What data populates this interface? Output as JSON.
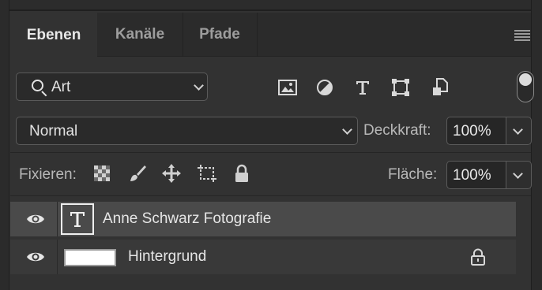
{
  "tabs": [
    {
      "label": "Ebenen",
      "active": true
    },
    {
      "label": "Kanäle",
      "active": false
    },
    {
      "label": "Pfade",
      "active": false
    }
  ],
  "filter": {
    "selected": "Art",
    "icons": [
      "image-filter-icon",
      "adjustment-filter-icon",
      "type-filter-icon",
      "shape-filter-icon",
      "smart-object-filter-icon"
    ]
  },
  "blend": {
    "mode": "Normal",
    "opacity_label": "Deckkraft:",
    "opacity_value": "100%"
  },
  "lock": {
    "label": "Fixieren:",
    "icons": [
      "lock-transparent-pixels-icon",
      "lock-image-pixels-icon",
      "lock-position-icon",
      "lock-artboard-icon",
      "lock-all-icon"
    ],
    "fill_label": "Fläche:",
    "fill_value": "100%"
  },
  "layers": [
    {
      "name": "Anne Schwarz Fotografie",
      "type": "text",
      "visible": true,
      "selected": true,
      "locked": false
    },
    {
      "name": "Hintergrund",
      "type": "background",
      "visible": true,
      "selected": false,
      "locked": true
    }
  ],
  "colors": {
    "panel": "#323232",
    "selected_layer": "#4a4a4a",
    "text": "#e6e6e6"
  }
}
